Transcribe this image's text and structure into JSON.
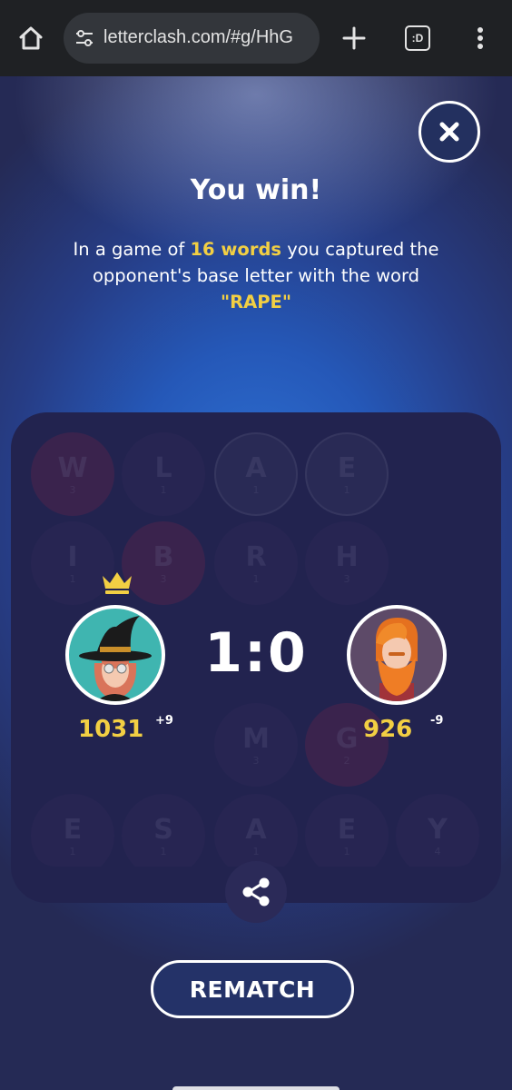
{
  "browser": {
    "url": "letterclash.com/#g/HhG",
    "tabs_label": ":D"
  },
  "result": {
    "title": "You win!",
    "msg_prefix": "In a game of ",
    "words_count": "16 words",
    "msg_middle": " you captured the opponent's base letter with the word ",
    "winning_word": "\"RAPE\""
  },
  "board": {
    "tiles": [
      {
        "letter": "W",
        "score": "3",
        "style": "red"
      },
      {
        "letter": "L",
        "score": "1",
        "style": "dim"
      },
      {
        "letter": "A",
        "score": "1",
        "style": "gray"
      },
      {
        "letter": "E",
        "score": "1",
        "style": "gray"
      },
      {
        "letter": "I",
        "score": "1",
        "style": "dim"
      },
      {
        "letter": "B",
        "score": "3",
        "style": "red"
      },
      {
        "letter": "R",
        "score": "1",
        "style": "dim"
      },
      {
        "letter": "H",
        "score": "3",
        "style": "dim"
      },
      {
        "letter": "M",
        "score": "3",
        "style": "dim"
      },
      {
        "letter": "G",
        "score": "2",
        "style": "red"
      },
      {
        "letter": "E",
        "score": "1",
        "style": "dim"
      },
      {
        "letter": "S",
        "score": "1",
        "style": "dim"
      },
      {
        "letter": "A",
        "score": "1",
        "style": "dim"
      },
      {
        "letter": "E",
        "score": "1",
        "style": "dim"
      },
      {
        "letter": "Y",
        "score": "4",
        "style": "dim"
      }
    ]
  },
  "players": {
    "left": {
      "rating": "1031",
      "delta": "+9",
      "winner": true
    },
    "right": {
      "rating": "926",
      "delta": "-9",
      "winner": false
    }
  },
  "score": "1:0",
  "buttons": {
    "rematch": "REMATCH"
  },
  "colors": {
    "accent_yellow": "#f2cf43",
    "panel": "#2b2a58"
  },
  "icons": [
    "home-icon",
    "tune-icon",
    "plus-icon",
    "tabs-icon",
    "more-vert-icon",
    "close-icon",
    "crown-icon",
    "share-icon"
  ]
}
